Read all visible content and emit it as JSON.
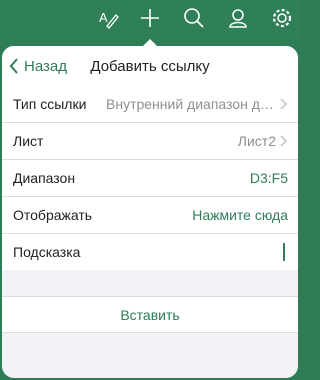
{
  "colors": {
    "accent": "#2e7d57",
    "toolbar": "#2f7f57"
  },
  "toolbar": {
    "icons": [
      "text-format-icon",
      "plus-icon",
      "search-icon",
      "user-icon",
      "gear-icon"
    ]
  },
  "popover": {
    "back_label": "Назад",
    "title": "Добавить ссылку",
    "rows": [
      {
        "label": "Тип ссылки",
        "value": "Внутренний диапазон да..."
      },
      {
        "label": "Лист",
        "value": "Лист2"
      },
      {
        "label": "Диапазон",
        "value": "D3:F5"
      },
      {
        "label": "Отображать",
        "value": "Нажмите сюда"
      },
      {
        "label": "Подсказка",
        "value": ""
      }
    ],
    "insert_label": "Вставить"
  }
}
